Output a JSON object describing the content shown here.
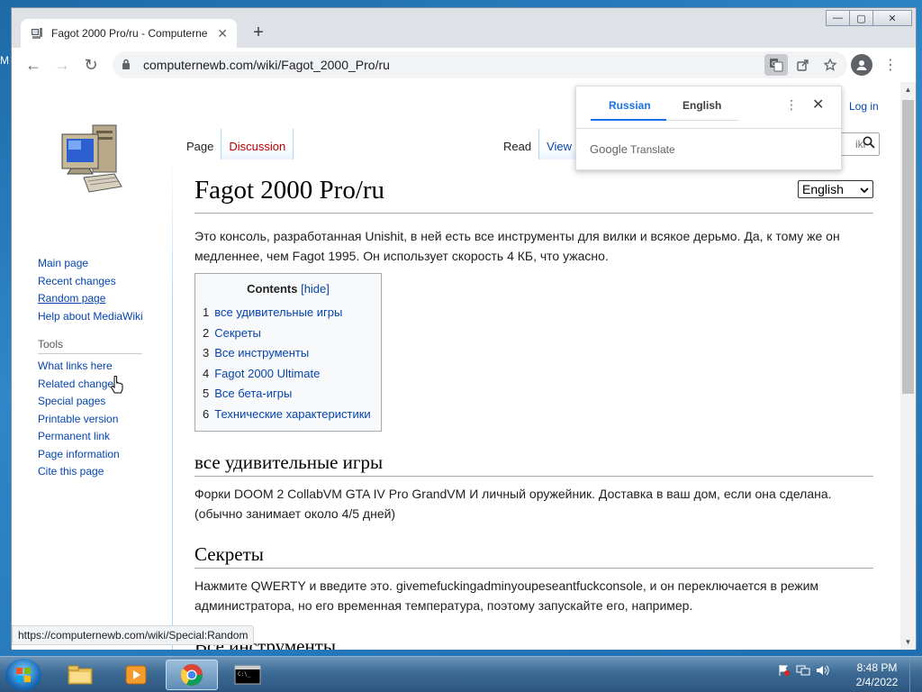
{
  "desktop": {
    "edge_text": "M"
  },
  "window": {
    "minimize": "—",
    "maximize": "▢",
    "close": "✕"
  },
  "tab": {
    "title": "Fagot 2000 Pro/ru - Computerne",
    "close": "✕",
    "new_tab": "+"
  },
  "toolbar": {
    "back": "←",
    "forward": "→",
    "reload": "↻",
    "url": "computernewb.com/wiki/Fagot_2000_Pro/ru",
    "menu": "⋮"
  },
  "translate": {
    "source_lang": "Russian",
    "target_lang": "English",
    "more": "⋮",
    "close": "✕",
    "brand_google": "Google",
    "brand_translate": "Translate"
  },
  "wiki": {
    "login": "Log in",
    "tabs_left": [
      "Page",
      "Discussion"
    ],
    "tabs_right": [
      "Read",
      "View s"
    ],
    "search_placeholder": "iki",
    "nav": [
      "Main page",
      "Recent changes",
      "Random page",
      "Help about MediaWiki"
    ],
    "tools_heading": "Tools",
    "tools": [
      "What links here",
      "Related changes",
      "Special pages",
      "Printable version",
      "Permanent link",
      "Page information",
      "Cite this page"
    ],
    "title": "Fagot 2000 Pro/ru",
    "language_select": "English",
    "intro": "Это консоль, разработанная Unishit, в ней есть все инструменты для вилки и всякое дерьмо. Да, к тому же он медленнее, чем Fagot 1995. Он использует скорость 4 КБ, что ужасно.",
    "toc": {
      "title": "Contents",
      "hide": "[hide]",
      "items": [
        {
          "num": "1",
          "label": "все удивительные игры"
        },
        {
          "num": "2",
          "label": "Секреты"
        },
        {
          "num": "3",
          "label": "Все инструменты"
        },
        {
          "num": "4",
          "label": "Fagot 2000 Ultimate"
        },
        {
          "num": "5",
          "label": "Все бета-игры"
        },
        {
          "num": "6",
          "label": "Технические характеристики"
        }
      ]
    },
    "sections": [
      {
        "heading": "все удивительные игры",
        "text": "Форки DOOM 2 CollabVM GTA IV Pro GrandVM И личный оружейник. Доставка в ваш дом, если она сделана. (обычно занимает около 4/5 дней)"
      },
      {
        "heading": "Секреты",
        "text": "Нажмите QWERTY и введите это. givemefuckingadminyoupeseantfuckconsole, и он переключается в режим администратора, но его временная температура, поэтому запускайте его, например."
      },
      {
        "heading": "Все инструменты",
        "text": ""
      }
    ],
    "status_url": "https://computernewb.com/wiki/Special:Random"
  },
  "taskbar": {
    "time": "8:48 PM",
    "date": "2/4/2022"
  }
}
